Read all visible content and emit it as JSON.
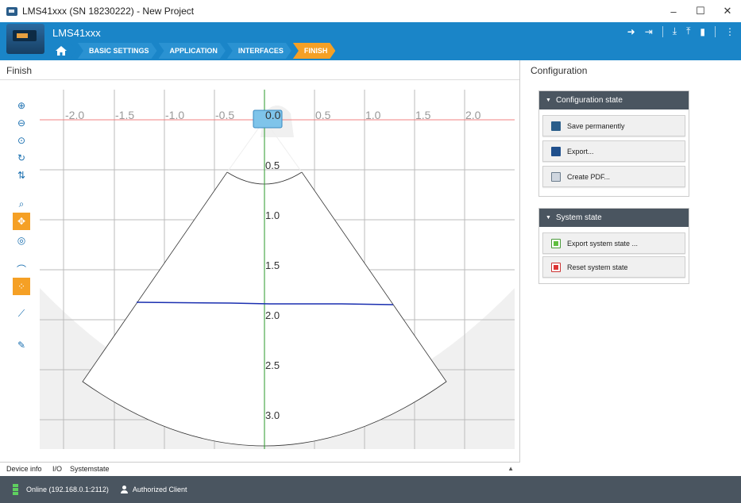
{
  "window": {
    "title": "LMS41xxx (SN 18230222) - New Project",
    "controls": [
      "–",
      "☐",
      "✕"
    ]
  },
  "header": {
    "device_name": "LMS41xxx",
    "tools": [
      "login-icon",
      "logout-icon",
      "download-icon",
      "upload-icon",
      "device-icon",
      "more-icon"
    ],
    "breadcrumb": [
      "BASIC SETTINGS",
      "APPLICATION",
      "INTERFACES",
      "FINISH"
    ],
    "active_step": "FINISH",
    "accent_color": "#f5a025",
    "brand_color": "#1a85c8"
  },
  "left_panel": {
    "title": "Finish",
    "toolbar_icons": [
      "zoom-in-icon",
      "zoom-out-icon",
      "zoom-fit-icon",
      "rotate-icon",
      "flip-icon",
      "search-icon",
      "pan-icon",
      "target-icon",
      "shape-icon",
      "points-icon",
      "measure-icon",
      "wrench-icon"
    ],
    "bottom_tabs": [
      "Device info",
      "I/O",
      "Systemstate"
    ]
  },
  "scan_view": {
    "x_ticks": [
      "-2.0",
      "-1.5",
      "-1.0",
      "-0.5",
      "0.0",
      "0.5",
      "1.0",
      "1.5",
      "2.0"
    ],
    "y_ticks": [
      "0.5",
      "1.0",
      "1.5",
      "2.0",
      "2.5",
      "3.0"
    ],
    "axis_color": "#2a9a2a",
    "scan_line_color": "#1a2fb0",
    "reference_line_color": "#f08080"
  },
  "right_panel": {
    "title": "Configuration",
    "sections": [
      {
        "title": "Configuration state",
        "buttons": [
          "Save permanently",
          "Export...",
          "Create PDF..."
        ]
      },
      {
        "title": "System state",
        "buttons": [
          "Export system state ...",
          "Reset system state"
        ]
      }
    ]
  },
  "status": {
    "connection": "Online (192.168.0.1:2112)",
    "user": "Authorized Client"
  }
}
